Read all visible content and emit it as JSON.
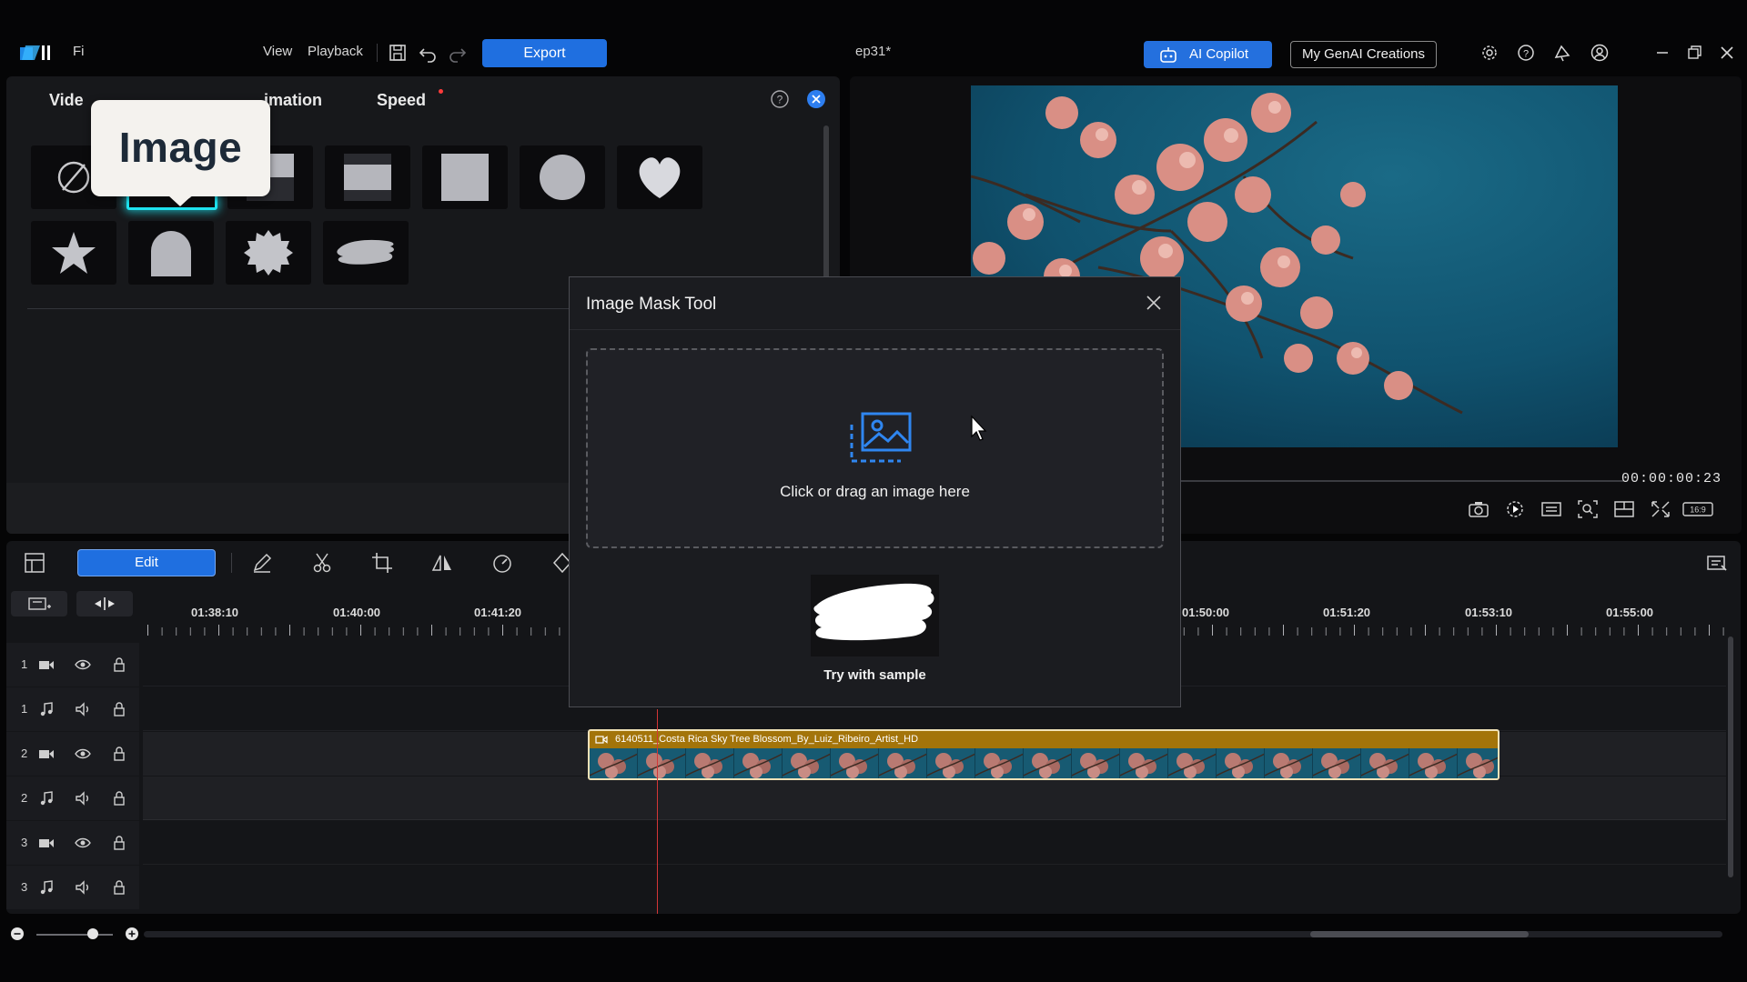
{
  "app": {
    "menus": [
      "Fi",
      "View",
      "Playback"
    ],
    "export_label": "Export",
    "project_title": "ep31*",
    "ai_copilot_label": "AI Copilot",
    "genai_label": "My GenAI Creations"
  },
  "tool_panel": {
    "tabs": [
      "Vide",
      "imation",
      "Speed"
    ],
    "tooltip": "Image",
    "masks": [
      "none-icon",
      "image-mask-icon",
      "half-top-icon",
      "band-icon",
      "square-icon",
      "circle-icon",
      "heart-icon",
      "star-icon",
      "arch-icon",
      "burst-icon",
      "brush-stroke-icon"
    ],
    "selected_mask": "image-mask-icon"
  },
  "preview": {
    "timecode": "00:00:00:23"
  },
  "timeline": {
    "edit_label": "Edit",
    "ruler_labels_left": [
      "01:38:10",
      "01:40:00",
      "01:41:20"
    ],
    "ruler_labels_right": [
      "01:50:00",
      "01:51:20",
      "01:53:10",
      "01:55:00"
    ],
    "tracks": [
      {
        "num": "1",
        "type": "video"
      },
      {
        "num": "1",
        "type": "audio"
      },
      {
        "num": "2",
        "type": "video"
      },
      {
        "num": "2",
        "type": "audio"
      },
      {
        "num": "3",
        "type": "video"
      },
      {
        "num": "3",
        "type": "audio"
      }
    ],
    "clip_name": "6140511_Costa Rica Sky Tree Blossom_By_Luiz_Ribeiro_Artist_HD"
  },
  "modal": {
    "title": "Image Mask Tool",
    "dropzone_text": "Click or drag an image here",
    "sample_text": "Try with sample"
  },
  "colors": {
    "accent": "#1f6fe0",
    "selection_glow": "#1ee3f0",
    "clip": "#a3740a",
    "playhead": "#d33636"
  }
}
